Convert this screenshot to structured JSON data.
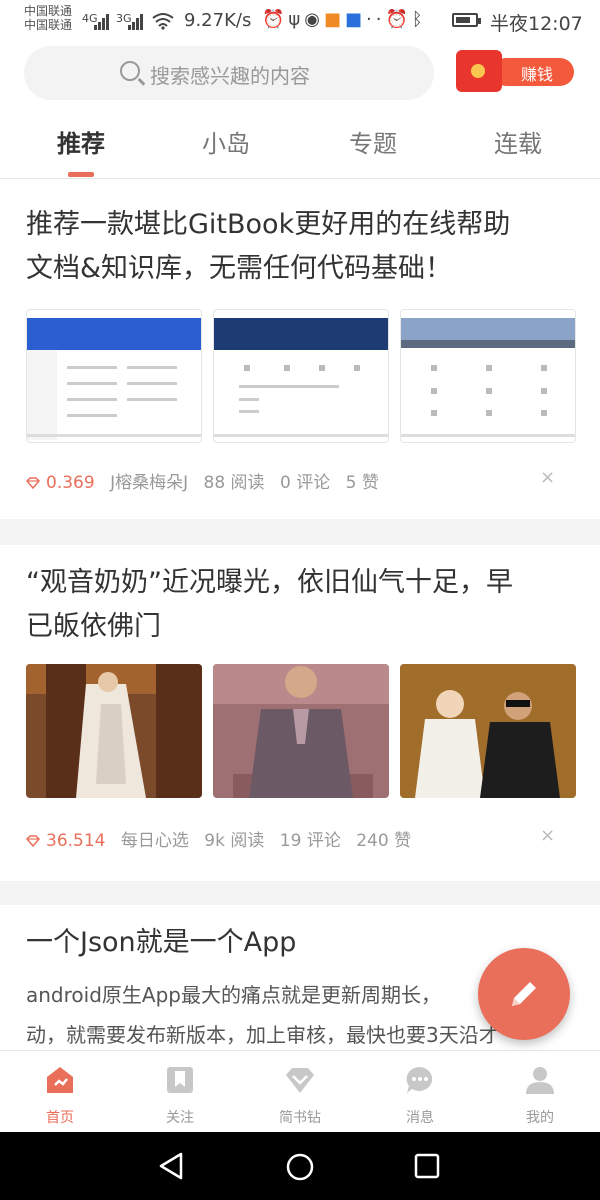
{
  "status_bar": {
    "carrier_1": "中国联通",
    "carrier_2": "中国联通",
    "net_1": "4G",
    "net_2": "3G",
    "speed": "9.27K/s",
    "time": "半夜12:07",
    "battery_level": 0.8
  },
  "search": {
    "placeholder": "搜索感兴趣的内容",
    "icon": "search-icon"
  },
  "earn": {
    "label": "赚钱",
    "icon": "red-envelope-icon"
  },
  "tabs": [
    {
      "label": "推荐",
      "active": true
    },
    {
      "label": "小岛",
      "active": false
    },
    {
      "label": "专题",
      "active": false
    },
    {
      "label": "连载",
      "active": false
    }
  ],
  "feed": [
    {
      "title_line1": "推荐一款堪比GitBook更好用的在线帮助",
      "title_line2": "文档&知识库，无需任何代码基础！",
      "price": "0.369",
      "author": "J榕桑梅朵J",
      "reads": "88 阅读",
      "comments": "0 评论",
      "likes": "5 赞",
      "close": "×"
    },
    {
      "title_line1": "“观音奶奶”近况曝光，依旧仙气十足，早",
      "title_line2": "已皈依佛门",
      "price": "36.514",
      "author": "每日心选",
      "reads": "9k 阅读",
      "comments": "19 评论",
      "likes": "240 赞",
      "close": "×"
    },
    {
      "title": "一个Json就是一个App",
      "desc_line1": "android原生App最大的痛点就是更新周期长，",
      "desc_line2": "动，就需要发布新版本，加上审核，最快也要3天沿才"
    }
  ],
  "bottom_nav": [
    {
      "label": "首页",
      "icon": "home-icon",
      "active": true
    },
    {
      "label": "关注",
      "icon": "bookmark-icon",
      "active": false
    },
    {
      "label": "简书钻",
      "icon": "diamond-icon",
      "active": false
    },
    {
      "label": "消息",
      "icon": "chat-icon",
      "active": false
    },
    {
      "label": "我的",
      "icon": "user-icon",
      "active": false
    }
  ],
  "colors": {
    "accent": "#ea6f5a",
    "text": "#333333",
    "muted": "#999999"
  }
}
